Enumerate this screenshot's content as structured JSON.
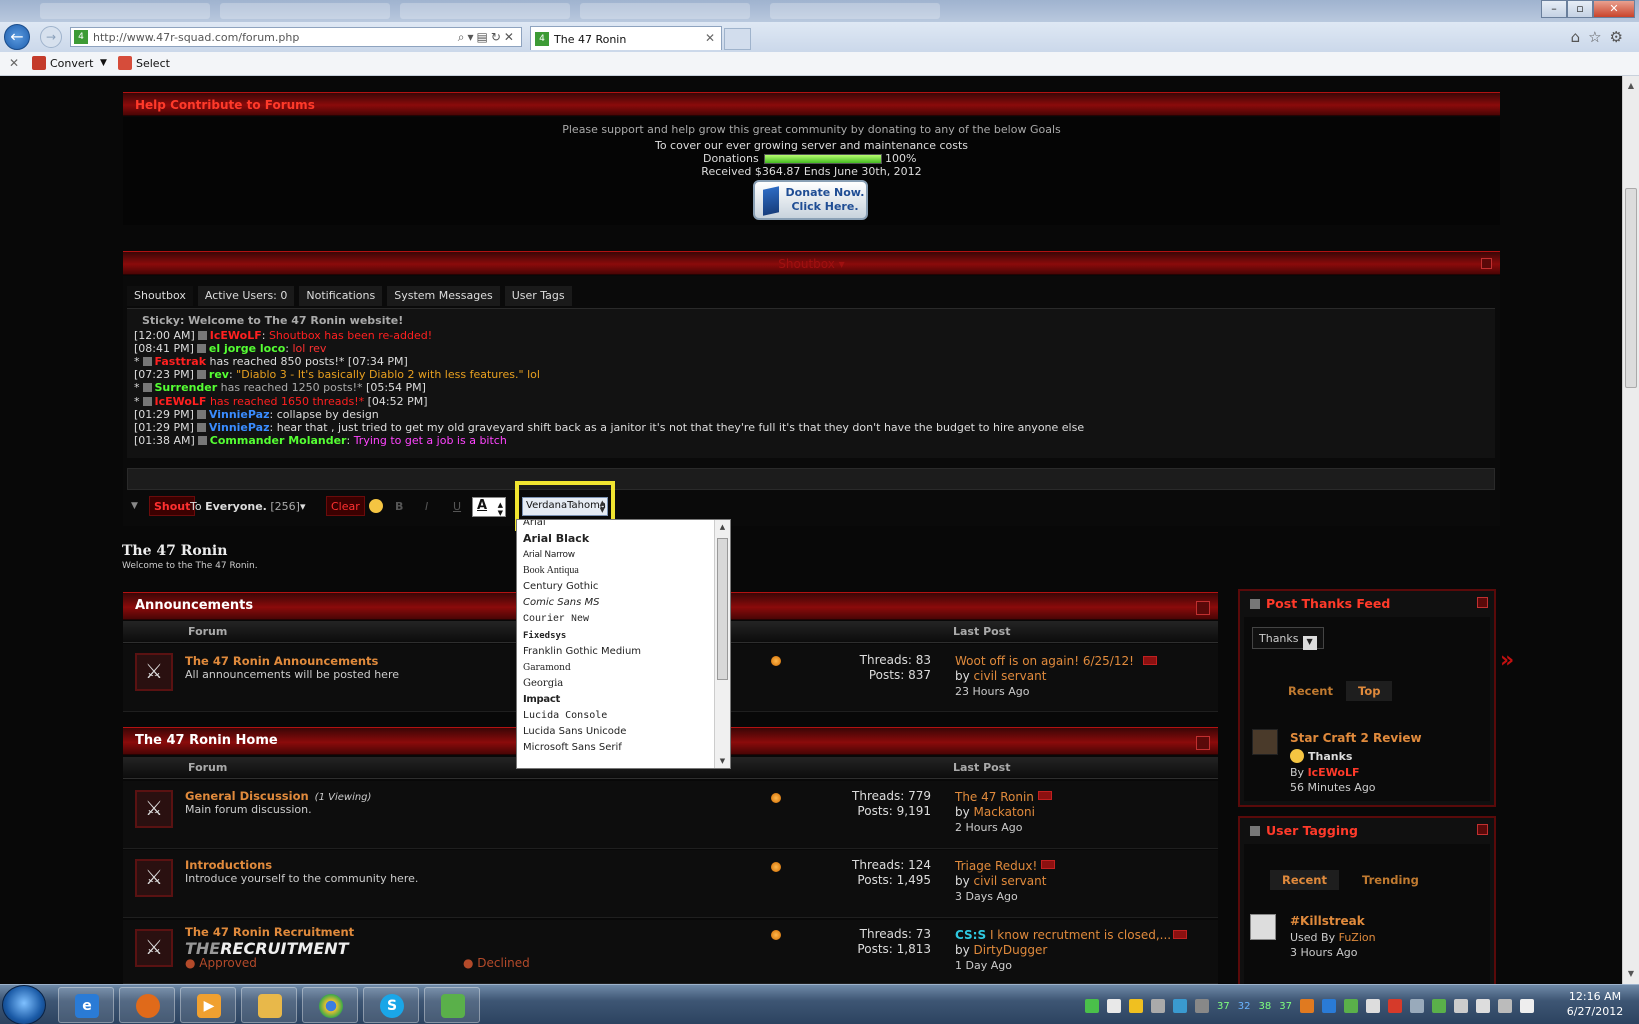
{
  "browser": {
    "url": "http://www.47r-squad.com/forum.php",
    "tab_title": "The 47 Ronin",
    "commands": {
      "convert": "Convert",
      "select": "Select"
    }
  },
  "donation": {
    "title": "Help Contribute to Forums",
    "intro": "Please support and help grow this great community by donating to any of the below Goals",
    "goal": "To cover our ever growing server and maintenance costs",
    "label": "Donations",
    "progress": 1.0,
    "progress_text": "100%",
    "received": "Received $364.87 Ends June 30th, 2012",
    "button_line1": "Donate Now.",
    "button_line2": "Click Here."
  },
  "shoutbox": {
    "title": "Shoutbox",
    "tabs": [
      "Shoutbox",
      "Active Users: 0",
      "Notifications",
      "System Messages",
      "User Tags"
    ],
    "sticky": "Sticky: Welcome to The 47 Ronin website!",
    "messages": [
      {
        "time": "[12:00 AM]",
        "user": "IcEWoLF",
        "msg": "Shoutbox has been re-added!",
        "ucolor": "#ff2020",
        "mcolor": "#ff2020",
        "after": ""
      },
      {
        "time": "[08:41 PM]",
        "user": "el jorge loco",
        "msg": "lol rev",
        "ucolor": "#55ff33",
        "mcolor": "#ff3030",
        "after": ""
      },
      {
        "time": "",
        "user": "Fasttrak",
        "msg": "has reached 850 posts!*",
        "ucolor": "#ff2020",
        "mcolor": "#dddddd",
        "after": "[07:34 PM]",
        "sys": true
      },
      {
        "time": "[07:23 PM]",
        "user": "rev",
        "msg": "\"Diablo 3 - It's basically Diablo 2 with less features.\" lol",
        "ucolor": "#55ff33",
        "mcolor": "#e8a020",
        "after": ""
      },
      {
        "time": "",
        "user": "Surrender",
        "msg": "has reached 1250 posts!*",
        "ucolor": "#55ff33",
        "mcolor": "#aaaaaa",
        "after": "[05:54 PM]",
        "sys": true
      },
      {
        "time": "",
        "user": "IcEWoLF",
        "msg": "has reached 1650 threads!*",
        "ucolor": "#ff2020",
        "mcolor": "#ff2020",
        "after": "[04:52 PM]",
        "sys": true
      },
      {
        "time": "[01:29 PM]",
        "user": "VinniePaz",
        "msg": "collapse by design",
        "ucolor": "#3a8cff",
        "mcolor": "#dddddd",
        "after": ""
      },
      {
        "time": "[01:29 PM]",
        "user": "VinniePaz",
        "msg": "hear that , just tried to get my old graveyard shift back as a janitor it's not that they're full it's that they don't have the budget to hire anyone else",
        "ucolor": "#3a8cff",
        "mcolor": "#dddddd",
        "after": ""
      },
      {
        "time": "[01:38 AM]",
        "user": "Commander Molander",
        "msg": "Trying to get a job is a bitch",
        "ucolor": "#55ff33",
        "mcolor": "#ff44ff",
        "after": ""
      }
    ],
    "toolbar": {
      "shout": "Shout",
      "to": "To",
      "everyone": "Everyone.",
      "count": "[256]",
      "clear": "Clear",
      "bold": "B",
      "italic": "I",
      "underline": "U",
      "color_a": "A",
      "font_value": "VerdanaTahoma"
    },
    "font_options": [
      "Arial",
      "Arial Black",
      "Arial Narrow",
      "Book Antiqua",
      "Century Gothic",
      "Comic Sans MS",
      "Courier New",
      "Fixedsys",
      "Franklin Gothic Medium",
      "Garamond",
      "Georgia",
      "Impact",
      "Lucida Console",
      "Lucida Sans Unicode",
      "Microsoft Sans Serif"
    ]
  },
  "forum": {
    "title": "The 47 Ronin",
    "subtitle": "Welcome to the The 47 Ronin.",
    "col_forum": "Forum",
    "col_lastpost": "Last Post",
    "categories": [
      {
        "title": "Announcements",
        "forums": [
          {
            "name": "The 47 Ronin Announcements",
            "desc": "All announcements will be posted here",
            "threads": "Threads: 83",
            "posts": "Posts: 837",
            "lp_title": "Woot off is on again! 6/25/12!",
            "lp_by": "by",
            "lp_user": "civil servant",
            "lp_ago": "23 Hours Ago",
            "viewing": ""
          }
        ]
      },
      {
        "title": "The 47 Ronin Home",
        "forums": [
          {
            "name": "General Discussion",
            "desc": "Main forum discussion.",
            "threads": "Threads: 779",
            "posts": "Posts: 9,191",
            "lp_title": "The 47 Ronin",
            "lp_by": "by",
            "lp_user": "Mackatoni",
            "lp_ago": "2 Hours Ago",
            "viewing": "(1 Viewing)"
          },
          {
            "name": "Introductions",
            "desc": "Introduce yourself to the community here.",
            "threads": "Threads: 124",
            "posts": "Posts: 1,495",
            "lp_title": "Triage Redux!",
            "lp_by": "by",
            "lp_user": "civil servant",
            "lp_ago": "3 Days Ago",
            "viewing": ""
          },
          {
            "name": "The 47 Ronin Recruitment",
            "desc": "",
            "threads": "Threads: 73",
            "posts": "Posts: 1,813",
            "lp_prefix": "CS:S",
            "lp_title": "I know recrutment is closed,...",
            "lp_by": "by",
            "lp_user": "DirtyDugger",
            "lp_ago": "1 Day Ago",
            "viewing": "",
            "logo_a": "THE",
            "logo_b": "RECRUITMENT",
            "approved": "Approved",
            "declined": "Declined"
          }
        ]
      }
    ]
  },
  "sidebar": {
    "thanks": {
      "title": "Post Thanks Feed",
      "select": "Thanks",
      "tab_recent": "Recent",
      "tab_top": "Top",
      "item_title": "Star Craft 2 Review",
      "item_type": "Thanks",
      "item_by": "By",
      "item_user": "IcEWoLF",
      "item_ago": "56 Minutes Ago"
    },
    "tagging": {
      "title": "User Tagging",
      "tab_recent": "Recent",
      "tab_trending": "Trending",
      "item_title": "#Killstreak",
      "item_used": "Used By",
      "item_user": "FuZion",
      "item_ago": "3 Hours Ago"
    }
  },
  "taskbar": {
    "tray_numbers": [
      "37",
      "32",
      "38",
      "37"
    ],
    "time": "12:16 AM",
    "date": "6/27/2012"
  }
}
